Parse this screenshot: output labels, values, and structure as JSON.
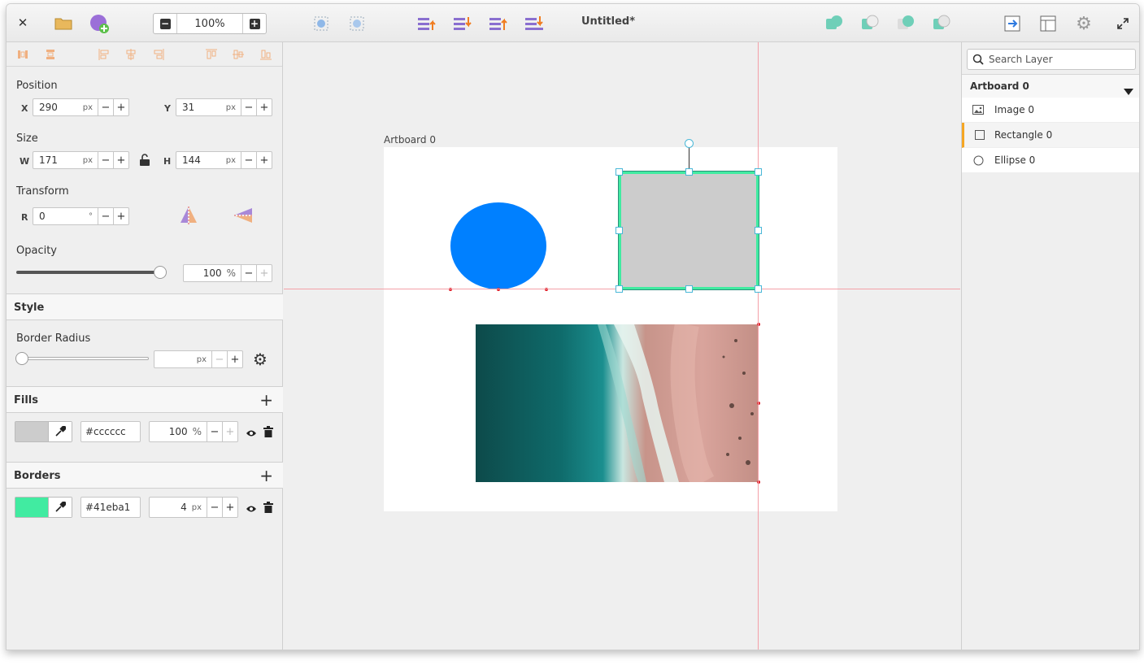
{
  "app": {
    "title": "Untitled*"
  },
  "toolbar": {
    "zoom_value": "100%",
    "zoom_minus": "−",
    "zoom_plus": "+"
  },
  "left": {
    "position": {
      "heading": "Position",
      "x_label": "X",
      "x_value": "290",
      "y_label": "Y",
      "y_value": "31",
      "unit": "px"
    },
    "size": {
      "heading": "Size",
      "w_label": "W",
      "w_value": "171",
      "h_label": "H",
      "h_value": "144",
      "unit": "px"
    },
    "transform": {
      "heading": "Transform",
      "r_label": "R",
      "r_value": "0",
      "unit": "°"
    },
    "opacity": {
      "heading": "Opacity",
      "value": "100",
      "unit": "%",
      "slider_fraction": 1.0
    },
    "style": {
      "heading": "Style"
    },
    "border_radius": {
      "heading": "Border Radius",
      "unit": "px",
      "value": "",
      "slider_fraction": 0.0
    },
    "fills": {
      "heading": "Fills",
      "color": "#cccccc",
      "hex": "#cccccc",
      "opacity": "100",
      "unit": "%"
    },
    "borders": {
      "heading": "Borders",
      "color": "#41eba1",
      "hex": "#41eba1",
      "width": "4",
      "unit": "px"
    }
  },
  "canvas": {
    "artboard_label": "Artboard 0",
    "ellipse_color": "#0080ff",
    "rect_fill": "#cccccc",
    "rect_border": "#41eba1"
  },
  "layers": {
    "search_placeholder": "Search Layer",
    "artboard": "Artboard 0",
    "items": [
      {
        "label": "Image 0",
        "icon": "image-icon"
      },
      {
        "label": "Rectangle 0",
        "icon": "rectangle-icon"
      },
      {
        "label": "Ellipse 0",
        "icon": "ellipse-icon"
      }
    ]
  },
  "colors": {
    "accent_selected": "#f5a623",
    "guide": "#f4a0a8"
  }
}
